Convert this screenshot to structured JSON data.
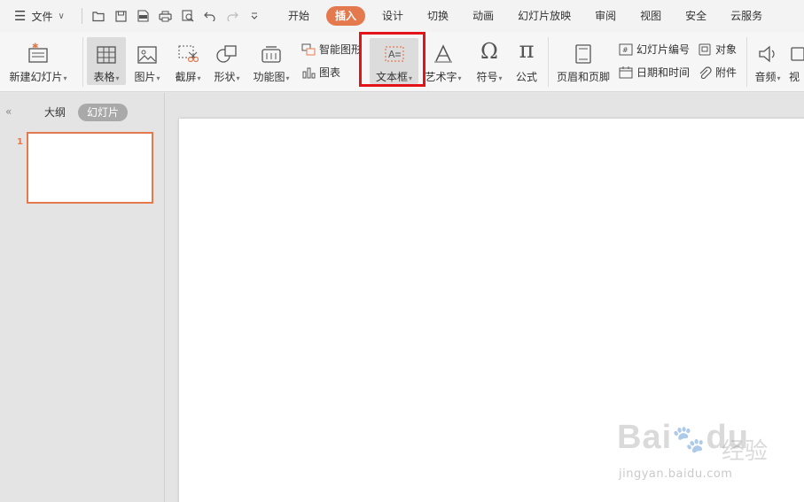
{
  "menubar": {
    "file_label": "文件",
    "tabs": [
      "开始",
      "插入",
      "设计",
      "切换",
      "动画",
      "幻灯片放映",
      "审阅",
      "视图",
      "安全",
      "云服务"
    ],
    "active_tab": "插入"
  },
  "ribbon": {
    "new_slide": "新建幻灯片",
    "table": "表格",
    "picture": "图片",
    "screenshot": "截屏",
    "shape": "形状",
    "function_chart": "功能图",
    "smartart": "智能图形",
    "chart": "图表",
    "textbox": "文本框",
    "wordart": "艺术字",
    "symbol": "符号",
    "formula": "公式",
    "header_footer": "页眉和页脚",
    "slide_number": "幻灯片编号",
    "object": "对象",
    "date_time": "日期和时间",
    "attachment": "附件",
    "audio": "音频",
    "video_partial": "视"
  },
  "leftpane": {
    "outline_tab": "大纲",
    "slides_tab": "幻灯片",
    "slide_number": "1"
  },
  "watermark": {
    "brand": "Bai",
    "brand2": "du",
    "chinese": "经验",
    "url": "jingyan.baidu.com"
  },
  "colors": {
    "accent": "#e5794e",
    "highlight": "#e2141a"
  }
}
